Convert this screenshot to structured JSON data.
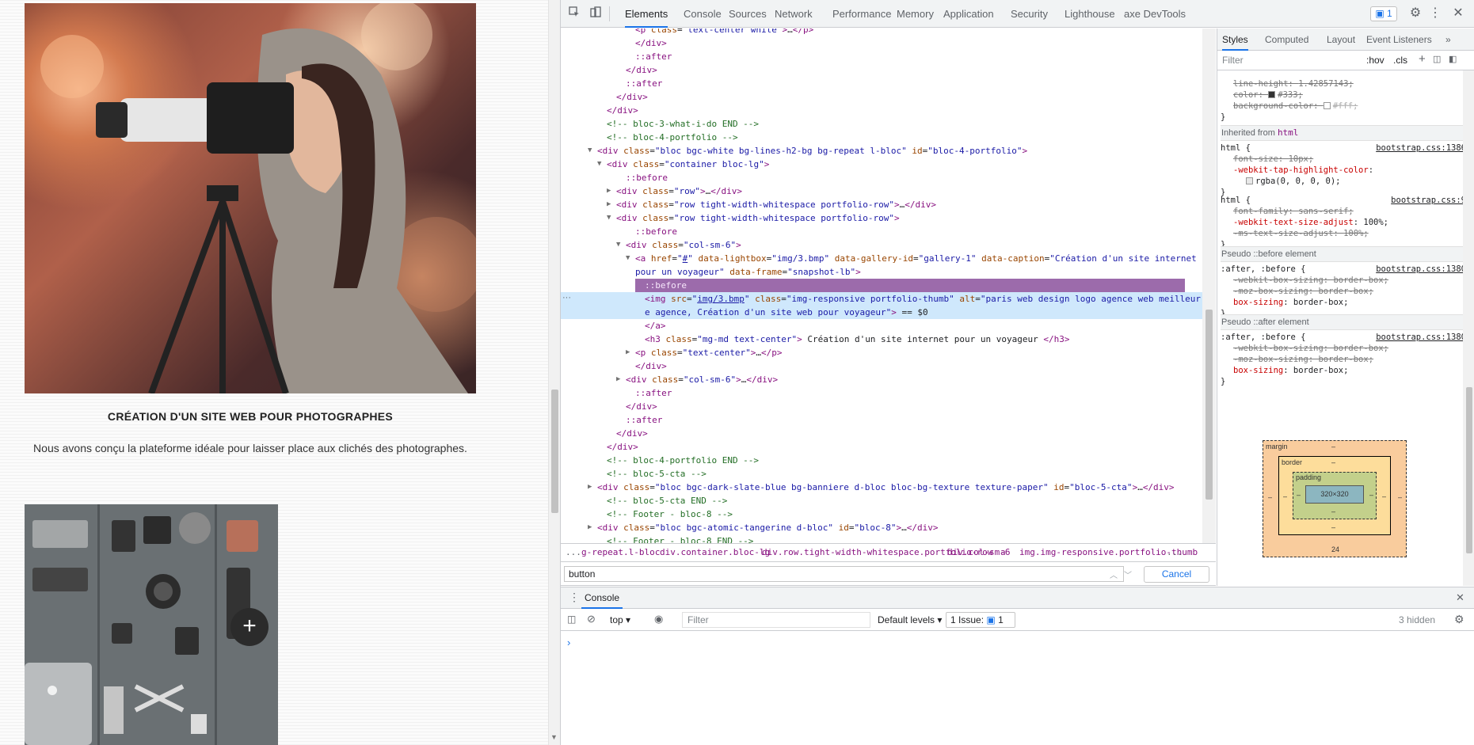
{
  "page": {
    "card1": {
      "title": "CRÉATION D'UN SITE WEB POUR PHOTOGRAPHES",
      "text": "Nous avons conçu la plateforme idéale pour laisser place aux clichés des photographes."
    },
    "plus_glyph": "+"
  },
  "devtools": {
    "tabs": [
      "Elements",
      "Console",
      "Sources",
      "Network",
      "Performance",
      "Memory",
      "Application",
      "Security",
      "Lighthouse",
      "axe DevTools"
    ],
    "active_tab": "Elements",
    "issue_badge": "1",
    "dom_lines": [
      {
        "indent": 6,
        "tri": "",
        "html": "<span class='tag'>&lt;p</span> <span class='attr'>class</span>=<span class='val'>\"text-center white\"</span><span class='tag'>&gt;</span>…<span class='tag'>&lt;/p&gt;</span>"
      },
      {
        "indent": 6,
        "tri": "",
        "html": "<span class='tag'>&lt;/div&gt;</span>"
      },
      {
        "indent": 6,
        "tri": "",
        "html": "<span class='pseudo'>::after</span>"
      },
      {
        "indent": 5,
        "tri": "",
        "html": "<span class='tag'>&lt;/div&gt;</span>"
      },
      {
        "indent": 5,
        "tri": "",
        "html": "<span class='pseudo'>::after</span>"
      },
      {
        "indent": 4,
        "tri": "",
        "html": "<span class='tag'>&lt;/div&gt;</span>"
      },
      {
        "indent": 3,
        "tri": "",
        "html": "<span class='tag'>&lt;/div&gt;</span>"
      },
      {
        "indent": 3,
        "tri": "",
        "html": "<span class='cmt'>&lt;!-- bloc-3-what-i-do END --&gt;</span>"
      },
      {
        "indent": 3,
        "tri": "",
        "html": "<span class='cmt'>&lt;!-- bloc-4-portfolio --&gt;</span>"
      },
      {
        "indent": 2,
        "tri": "▼",
        "html": "<span class='tag'>&lt;div</span> <span class='attr'>class</span>=<span class='val'>\"bloc bgc-white bg-lines-h2-bg bg-repeat l-bloc\"</span> <span class='attr'>id</span>=<span class='val'>\"bloc-4-portfolio\"</span><span class='tag'>&gt;</span>"
      },
      {
        "indent": 3,
        "tri": "▼",
        "html": "<span class='tag'>&lt;div</span> <span class='attr'>class</span>=<span class='val'>\"container bloc-lg\"</span><span class='tag'>&gt;</span>"
      },
      {
        "indent": 5,
        "tri": "",
        "html": "<span class='pseudo'>::before</span>"
      },
      {
        "indent": 4,
        "tri": "▶",
        "html": "<span class='tag'>&lt;div</span> <span class='attr'>class</span>=<span class='val'>\"row\"</span><span class='tag'>&gt;</span>…<span class='tag'>&lt;/div&gt;</span>"
      },
      {
        "indent": 4,
        "tri": "▶",
        "html": "<span class='tag'>&lt;div</span> <span class='attr'>class</span>=<span class='val'>\"row tight-width-whitespace portfolio-row\"</span><span class='tag'>&gt;</span>…<span class='tag'>&lt;/div&gt;</span>"
      },
      {
        "indent": 4,
        "tri": "▼",
        "html": "<span class='tag'>&lt;div</span> <span class='attr'>class</span>=<span class='val'>\"row tight-width-whitespace portfolio-row\"</span><span class='tag'>&gt;</span>"
      },
      {
        "indent": 6,
        "tri": "",
        "html": "<span class='pseudo'>::before</span>"
      },
      {
        "indent": 5,
        "tri": "▼",
        "html": "<span class='tag'>&lt;div</span> <span class='attr'>class</span>=<span class='val'>\"col-sm-6\"</span><span class='tag'>&gt;</span>"
      },
      {
        "indent": 6,
        "tri": "▼",
        "html": "<span class='tag'>&lt;a</span> <span class='attr'>href</span>=<span class='val'>\"<span class='link'>#</span>\"</span> <span class='attr'>data-lightbox</span>=<span class='val'>\"img/3.bmp\"</span> <span class='attr'>data-gallery-id</span>=<span class='val'>\"gallery-1\"</span> <span class='attr'>data-caption</span>=<span class='val'>\"Création d'un site internet</span>"
      },
      {
        "indent": 6,
        "tri": "",
        "html": "<span class='val'>pour un voyageur\"</span> <span class='attr'>data-frame</span>=<span class='val'>\"snapshot-lb\"</span><span class='tag'>&gt;</span>"
      },
      {
        "indent": 7,
        "tri": "",
        "pseudoSel": true,
        "html": "::before"
      },
      {
        "indent": 7,
        "tri": "",
        "selected": true,
        "html": "<span class='tag'>&lt;img</span> <span class='attr'>src</span>=<span class='val'>\"<span class='link'>img/3.bmp</span>\"</span> <span class='attr'>class</span>=<span class='val'>\"img-responsive portfolio-thumb\"</span> <span class='attr'>alt</span>=<span class='val'>\"paris web design logo agence web meilleur</span>"
      },
      {
        "indent": 7,
        "tri": "",
        "selected": true,
        "html": "<span class='val'>e agence, Création d'un site web pour voyageur\"</span><span class='tag'>&gt;</span> == $0"
      },
      {
        "indent": 7,
        "tri": "",
        "html": "<span class='tag'>&lt;/a&gt;</span>"
      },
      {
        "indent": 7,
        "tri": "",
        "html": "<span class='tag'>&lt;h3</span> <span class='attr'>class</span>=<span class='val'>\"mg-md text-center\"</span><span class='tag'>&gt;</span> Création d'un site internet pour un voyageur <span class='tag'>&lt;/h3&gt;</span>"
      },
      {
        "indent": 6,
        "tri": "▶",
        "html": "<span class='tag'>&lt;p</span> <span class='attr'>class</span>=<span class='val'>\"text-center\"</span><span class='tag'>&gt;</span>…<span class='tag'>&lt;/p&gt;</span>"
      },
      {
        "indent": 6,
        "tri": "",
        "html": "<span class='tag'>&lt;/div&gt;</span>"
      },
      {
        "indent": 5,
        "tri": "▶",
        "html": "<span class='tag'>&lt;div</span> <span class='attr'>class</span>=<span class='val'>\"col-sm-6\"</span><span class='tag'>&gt;</span>…<span class='tag'>&lt;/div&gt;</span>"
      },
      {
        "indent": 6,
        "tri": "",
        "html": "<span class='pseudo'>::after</span>"
      },
      {
        "indent": 5,
        "tri": "",
        "html": "<span class='tag'>&lt;/div&gt;</span>"
      },
      {
        "indent": 5,
        "tri": "",
        "html": "<span class='pseudo'>::after</span>"
      },
      {
        "indent": 4,
        "tri": "",
        "html": "<span class='tag'>&lt;/div&gt;</span>"
      },
      {
        "indent": 3,
        "tri": "",
        "html": "<span class='tag'>&lt;/div&gt;</span>"
      },
      {
        "indent": 3,
        "tri": "",
        "html": "<span class='cmt'>&lt;!-- bloc-4-portfolio END --&gt;</span>"
      },
      {
        "indent": 3,
        "tri": "",
        "html": "<span class='cmt'>&lt;!-- bloc-5-cta --&gt;</span>"
      },
      {
        "indent": 2,
        "tri": "▶",
        "html": "<span class='tag'>&lt;div</span> <span class='attr'>class</span>=<span class='val'>\"bloc bgc-dark-slate-blue bg-banniere d-bloc bloc-bg-texture texture-paper\"</span> <span class='attr'>id</span>=<span class='val'>\"bloc-5-cta\"</span><span class='tag'>&gt;</span>…<span class='tag'>&lt;/div&gt;</span>"
      },
      {
        "indent": 3,
        "tri": "",
        "html": "<span class='cmt'>&lt;!-- bloc-5-cta END --&gt;</span>"
      },
      {
        "indent": 3,
        "tri": "",
        "html": "<span class='cmt'>&lt;!-- Footer - bloc-8 --&gt;</span>"
      },
      {
        "indent": 2,
        "tri": "▶",
        "html": "<span class='tag'>&lt;div</span> <span class='attr'>class</span>=<span class='val'>\"bloc bgc-atomic-tangerine d-bloc\"</span> <span class='attr'>id</span>=<span class='val'>\"bloc-8\"</span><span class='tag'>&gt;</span>…<span class='tag'>&lt;/div&gt;</span>"
      },
      {
        "indent": 3,
        "tri": "",
        "html": "<span class='cmt'>&lt;!-- Footer - bloc-8 END --&gt;</span>"
      }
    ],
    "breadcrumb": [
      "...",
      "g-repeat.l-bloc",
      "div.container.bloc-lg",
      "div.row.tight-width-whitespace.portfolio-row",
      "div.col-sm-6",
      "a",
      "img.img-responsive.portfolio-thumb",
      "..."
    ],
    "search": {
      "value": "button",
      "cancel_label": "Cancel"
    },
    "styles": {
      "tabs": [
        "Styles",
        "Computed",
        "Layout",
        "Event Listeners",
        "»"
      ],
      "filter_placeholder": "Filter",
      "hov": ":hov",
      "cls": ".cls",
      "top_rule": [
        {
          "prop": "line-height",
          "val": "1.42857143;",
          "strike": true
        },
        {
          "prop": "color",
          "val": "#333;",
          "strike": true,
          "swatch": "#333333"
        },
        {
          "prop": "background-color",
          "val": "#fff;",
          "strike": true,
          "swatch": "#ffffff",
          "faded": true
        }
      ],
      "inherited_label": "Inherited from",
      "inherited_tag": "html",
      "html_rule1": {
        "selector": "html {",
        "src": "bootstrap.css:1386",
        "props": [
          {
            "prop": "font-size",
            "val": "10px;",
            "strike": true
          },
          {
            "prop": "-webkit-tap-highlight-color",
            "val": ""
          },
          {
            "prop": "",
            "val": "rgba(0, 0, 0, 0);",
            "swatch": "#e8e8e8"
          }
        ]
      },
      "html_rule2": {
        "selector": "html {",
        "src": "bootstrap.css:9",
        "props": [
          {
            "prop": "font-family",
            "val": "sans-serif;",
            "strike": true
          },
          {
            "prop": "-webkit-text-size-adjust",
            "val": "100%;"
          },
          {
            "prop": "-ms-text-size-adjust",
            "val": "100%;",
            "strike": true
          }
        ]
      },
      "before_header": "Pseudo ::before element",
      "before_rule": {
        "selector": ":after, :before {",
        "src": "bootstrap.css:1380",
        "props": [
          {
            "prop": "-webkit-box-sizing",
            "val": "border-box;",
            "strike": true
          },
          {
            "prop": "-moz-box-sizing",
            "val": "border-box;",
            "strike": true
          },
          {
            "prop": "box-sizing",
            "val": "border-box;"
          }
        ]
      },
      "after_header": "Pseudo ::after element",
      "after_rule": {
        "selector": ":after, :before {",
        "src": "bootstrap.css:1380",
        "props": [
          {
            "prop": "-webkit-box-sizing",
            "val": "border-box;",
            "strike": true
          },
          {
            "prop": "-moz-box-sizing",
            "val": "border-box;",
            "strike": true
          },
          {
            "prop": "box-sizing",
            "val": "border-box;"
          }
        ]
      },
      "close_brace": "}",
      "box_model": {
        "margin": "margin",
        "border": "border",
        "padding": "padding",
        "content": "320×320",
        "dash": "–",
        "bottom_value": "24"
      }
    },
    "console": {
      "tab": "Console",
      "context": "top",
      "filter_placeholder": "Filter",
      "levels": "Default levels",
      "issues": "1 Issue:",
      "issues_count": "1",
      "hidden": "3 hidden",
      "prompt": "›"
    }
  }
}
